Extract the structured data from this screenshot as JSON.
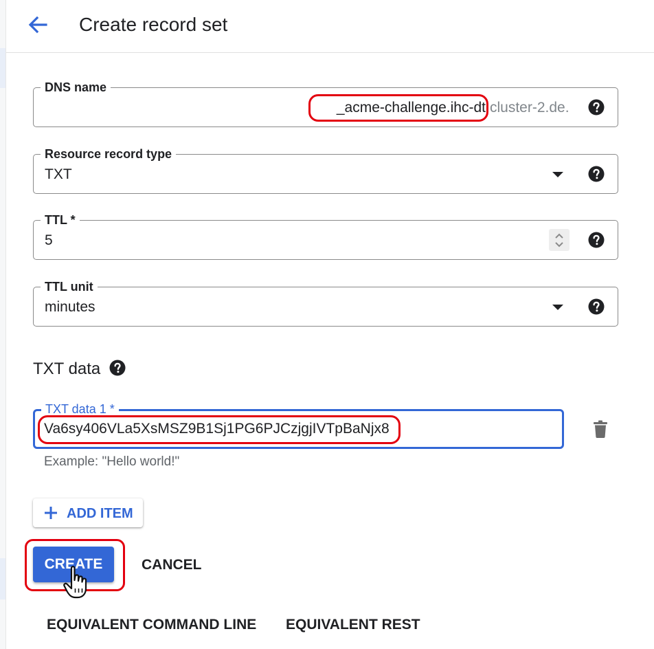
{
  "header": {
    "title": "Create record set"
  },
  "dns_name": {
    "label": "DNS name",
    "value": "_acme-challenge.ihc-dt",
    "suffix": "cluster-2.de."
  },
  "record_type": {
    "label": "Resource record type",
    "value": "TXT"
  },
  "ttl": {
    "label": "TTL *",
    "value": "5"
  },
  "ttl_unit": {
    "label": "TTL unit",
    "value": "minutes"
  },
  "txt_section": {
    "title": "TXT data"
  },
  "txt_data_1": {
    "label": "TXT data 1 *",
    "value": "Va6sy406VLa5XsMSZ9B1Sj1PG6PJCzjgjIVTpBaNjx8",
    "hint": "Example: \"Hello world!\""
  },
  "buttons": {
    "add_item": "ADD ITEM",
    "create": "CREATE",
    "cancel": "CANCEL",
    "equivalent_cli": "EQUIVALENT COMMAND LINE",
    "equivalent_rest": "EQUIVALENT REST"
  },
  "colors": {
    "accent": "#3367d6",
    "annotation": "#e3000f",
    "text": "#202124",
    "muted": "#80868b"
  },
  "icons": [
    "back-arrow-icon",
    "help-icon",
    "dropdown-caret-icon",
    "stepper-icon",
    "trash-icon",
    "plus-icon",
    "hand-cursor-icon"
  ]
}
